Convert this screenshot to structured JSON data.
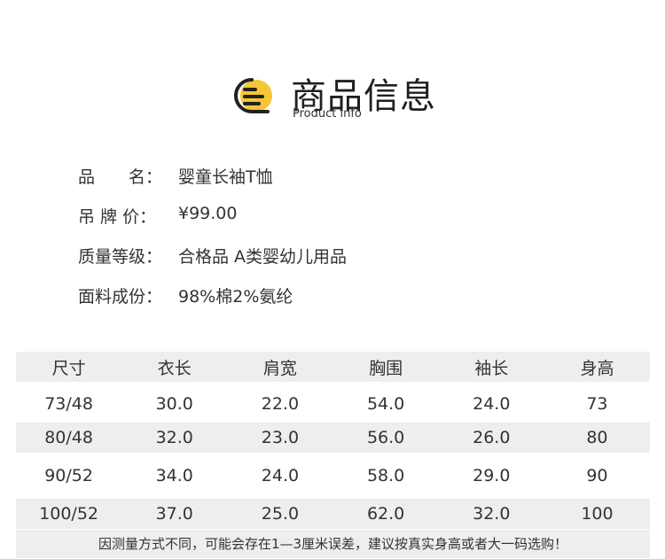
{
  "header": {
    "title": "商品信息",
    "subtitle": "Product info",
    "icon": "document-lines-icon",
    "colors": {
      "accent": "#F7C637",
      "outline": "#222222"
    }
  },
  "info": [
    {
      "label": "品　　名：",
      "value": "婴童长袖T恤"
    },
    {
      "label": "吊 牌 价：",
      "value": "¥99.00"
    },
    {
      "label": "质量等级：",
      "value": "合格品 A类婴幼儿用品"
    },
    {
      "label": "面料成份：",
      "value": "98%棉2%氨纶"
    }
  ],
  "table": {
    "headers": [
      "尺寸",
      "衣长",
      "肩宽",
      "胸围",
      "袖长",
      "身高"
    ],
    "rows": [
      [
        "73/48",
        "30.0",
        "22.0",
        "54.0",
        "24.0",
        "73"
      ],
      [
        "80/48",
        "32.0",
        "23.0",
        "56.0",
        "26.0",
        "80"
      ],
      [
        "90/52",
        "34.0",
        "24.0",
        "58.0",
        "29.0",
        "90"
      ],
      [
        "100/52",
        "37.0",
        "25.0",
        "62.0",
        "32.0",
        "100"
      ]
    ]
  },
  "note": "因测量方式不同，可能会存在1—3厘米误差，建议按真实身高或者大一码选购！"
}
